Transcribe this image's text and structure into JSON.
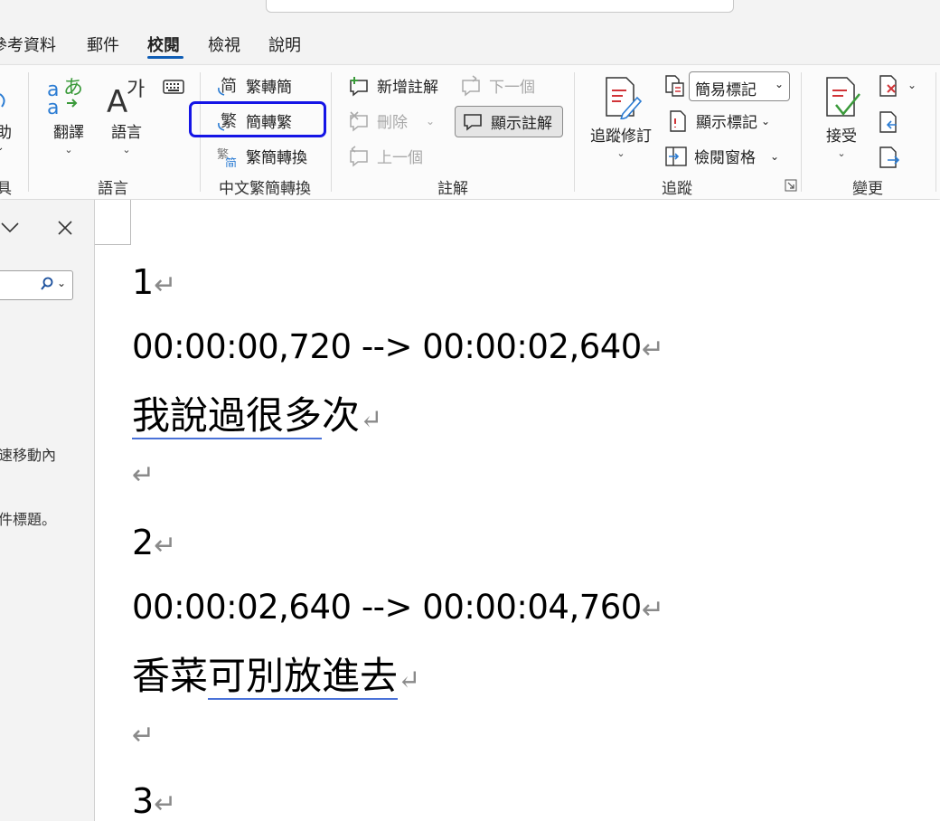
{
  "tabs": [
    "參考資料",
    "郵件",
    "校閱",
    "檢視",
    "說明"
  ],
  "active_tab": "校閱",
  "ribbon": {
    "left_partial_label": "助",
    "left_partial_group": "具",
    "language_group": {
      "label": "語言",
      "translate": "翻譯",
      "language": "語言"
    },
    "chinese_group": {
      "label": "中文繁簡轉換",
      "to_simplified": "繁轉簡",
      "to_traditional": "簡轉繁",
      "convert": "繁簡轉換"
    },
    "comments_group": {
      "label": "註解",
      "new_comment": "新增註解",
      "delete": "刪除",
      "previous": "上一個",
      "next": "下一個",
      "show_comments": "顯示註解"
    },
    "tracking_group": {
      "label": "追蹤",
      "track_changes": "追蹤修訂",
      "markup_select": "簡易標記",
      "show_markup": "顯示標記",
      "reviewing_pane": "檢閱窗格"
    },
    "changes_group": {
      "label": "變更",
      "accept": "接受"
    }
  },
  "left_pane": {
    "text1": "速移動內",
    "text2": "件標題。"
  },
  "document": {
    "blocks": [
      {
        "num": "1",
        "time": "00:00:00,720 --> 00:00:02,640",
        "text_a": "我說過很多",
        "text_b": "次"
      },
      {
        "num": "2",
        "time": "00:00:02,640 --> 00:00:04,760",
        "text_a": "香菜",
        "text_b": "可別放進去"
      },
      {
        "num": "3"
      }
    ],
    "para_mark": "↵"
  },
  "colors": {
    "accent": "#0f5db5",
    "highlight_box": "#1515e6"
  }
}
